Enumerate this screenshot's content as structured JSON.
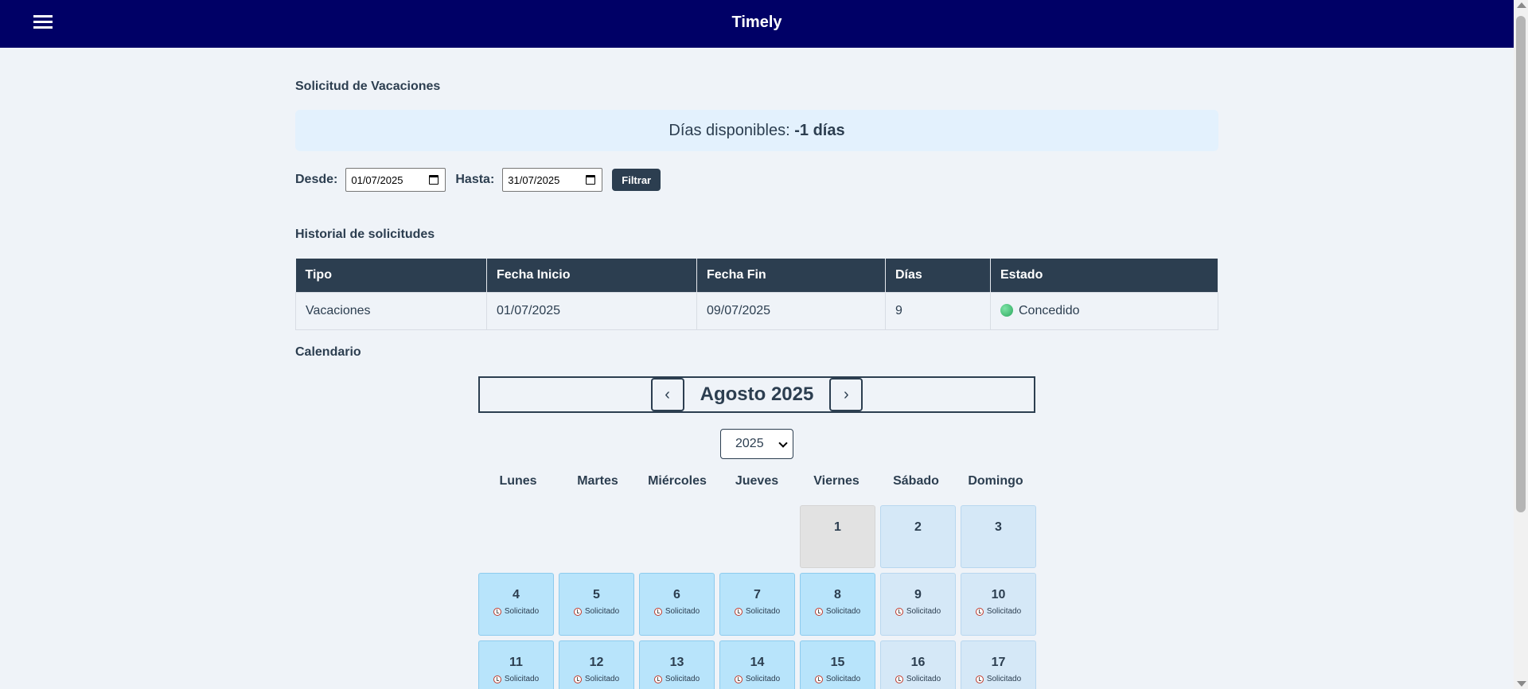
{
  "header": {
    "title": "Timely",
    "menu_icon": "hamburger-menu-icon"
  },
  "vacation": {
    "title": "Solicitud de Vacaciones",
    "available_label": "Días disponibles: ",
    "available_value": "-1 días"
  },
  "filter": {
    "from_label": "Desde:",
    "from_value": "01/07/2025",
    "to_label": "Hasta:",
    "to_value": "31/07/2025",
    "button_label": "Filtrar"
  },
  "history": {
    "title": "Historial de solicitudes",
    "columns": [
      "Tipo",
      "Fecha Inicio",
      "Fecha Fin",
      "Días",
      "Estado"
    ],
    "rows": [
      {
        "tipo": "Vacaciones",
        "inicio": "01/07/2025",
        "fin": "09/07/2025",
        "dias": "9",
        "estado": "Concedido"
      }
    ]
  },
  "calendar": {
    "title": "Calendario",
    "month_title": "Agosto 2025",
    "prev_label": "‹",
    "next_label": "›",
    "year_selected": "2025",
    "weekdays": [
      "Lunes",
      "Martes",
      "Miércoles",
      "Jueves",
      "Viernes",
      "Sábado",
      "Domingo"
    ],
    "status_label": "Solicitado",
    "days": [
      {
        "n": "1",
        "kind": "past",
        "tag": ""
      },
      {
        "n": "2",
        "kind": "weekend",
        "tag": ""
      },
      {
        "n": "3",
        "kind": "weekend",
        "tag": ""
      },
      {
        "n": "4",
        "kind": "req",
        "tag": "Solicitado"
      },
      {
        "n": "5",
        "kind": "req",
        "tag": "Solicitado"
      },
      {
        "n": "6",
        "kind": "req",
        "tag": "Solicitado"
      },
      {
        "n": "7",
        "kind": "req",
        "tag": "Solicitado"
      },
      {
        "n": "8",
        "kind": "req",
        "tag": "Solicitado"
      },
      {
        "n": "9",
        "kind": "weekend",
        "tag": "Solicitado"
      },
      {
        "n": "10",
        "kind": "weekend",
        "tag": "Solicitado"
      },
      {
        "n": "11",
        "kind": "req",
        "tag": "Solicitado"
      },
      {
        "n": "12",
        "kind": "req",
        "tag": "Solicitado"
      },
      {
        "n": "13",
        "kind": "req",
        "tag": "Solicitado"
      },
      {
        "n": "14",
        "kind": "req",
        "tag": "Solicitado"
      },
      {
        "n": "15",
        "kind": "req",
        "tag": "Solicitado"
      },
      {
        "n": "16",
        "kind": "weekend",
        "tag": "Solicitado"
      },
      {
        "n": "17",
        "kind": "weekend",
        "tag": "Solicitado"
      }
    ]
  },
  "colors": {
    "topbar": "#000066",
    "primary": "#2c3e50",
    "status_ok": "#2ca85e"
  }
}
